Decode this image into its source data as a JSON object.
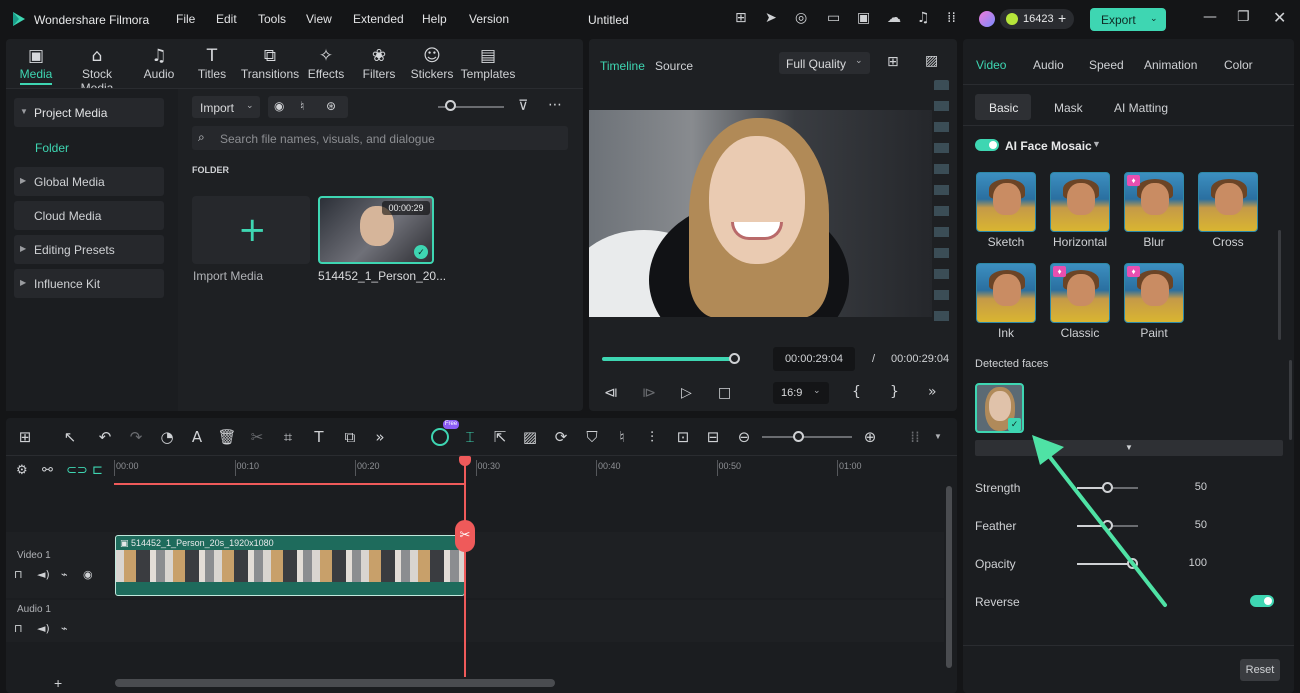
{
  "app": {
    "name": "Wondershare Filmora",
    "doc_title": "Untitled"
  },
  "menu": [
    "File",
    "Edit",
    "Tools",
    "View",
    "Extended",
    "Help",
    "Version"
  ],
  "credits": "16423",
  "export_label": "Export",
  "media_tabs": [
    {
      "label": "Media",
      "icon": "media-icon",
      "active": true
    },
    {
      "label": "Stock Media",
      "icon": "stock-media-icon"
    },
    {
      "label": "Audio",
      "icon": "music-note-icon"
    },
    {
      "label": "Titles",
      "icon": "title-t-icon"
    },
    {
      "label": "Transitions",
      "icon": "transition-icon"
    },
    {
      "label": "Effects",
      "icon": "effects-star-icon"
    },
    {
      "label": "Filters",
      "icon": "filters-icon"
    },
    {
      "label": "Stickers",
      "icon": "sticker-icon"
    },
    {
      "label": "Templates",
      "icon": "templates-icon"
    }
  ],
  "sidebar": {
    "items": [
      {
        "label": "Project Media",
        "expanded": true
      },
      {
        "label": "Folder",
        "active": true
      },
      {
        "label": "Global Media"
      },
      {
        "label": "Cloud Media"
      },
      {
        "label": "Editing Presets"
      },
      {
        "label": "Influence Kit"
      }
    ]
  },
  "library": {
    "import_label": "Import",
    "search_placeholder": "Search file names, visuals, and dialogue",
    "section": "FOLDER",
    "import_media": "Import Media",
    "clip_name": "514452_1_Person_20...",
    "clip_duration": "00:00:29"
  },
  "preview": {
    "tabs": [
      "Timeline",
      "Source"
    ],
    "quality": "Full Quality",
    "current_time": "00:00:29:04",
    "total_time": "00:00:29:04",
    "separator": "/",
    "aspect": "16:9",
    "progress": 1.0
  },
  "timeline": {
    "ruler": [
      "00:00",
      "00:10",
      "00:20",
      "00:30",
      "00:40",
      "00:50",
      "01:00"
    ],
    "tracks": [
      {
        "label": "Video 1"
      },
      {
        "label": "Audio 1"
      }
    ],
    "clip_label": "514452_1_Person_20s_1920x1080",
    "free_badge": "Free"
  },
  "inspector": {
    "tabs": [
      "Video",
      "Audio",
      "Speed",
      "Animation",
      "Color"
    ],
    "subtabs": [
      "Basic",
      "Mask",
      "AI Matting"
    ],
    "section": "AI Face Mosaic",
    "effects": [
      {
        "label": "Sketch",
        "premium": false
      },
      {
        "label": "Horizontal",
        "premium": false
      },
      {
        "label": "Blur",
        "premium": true
      },
      {
        "label": "Cross",
        "premium": false
      },
      {
        "label": "Ink",
        "premium": false
      },
      {
        "label": "Classic",
        "premium": true
      },
      {
        "label": "Paint",
        "premium": true
      }
    ],
    "detected_faces": "Detected faces",
    "props": [
      {
        "label": "Strength",
        "value": "50",
        "level": 0.5
      },
      {
        "label": "Feather",
        "value": "50",
        "level": 0.5
      },
      {
        "label": "Opacity",
        "value": "100",
        "level": 1.0
      }
    ],
    "reverse_label": "Reverse",
    "reset_label": "Reset"
  },
  "colors": {
    "accent": "#3ed6b2",
    "playhead": "#ef5a5a",
    "premium": "#e94fb0"
  }
}
